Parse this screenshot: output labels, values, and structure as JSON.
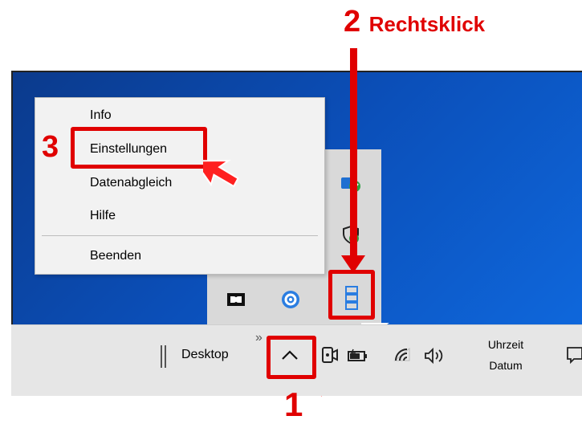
{
  "annotations": {
    "step1": "1",
    "step2_number": "2",
    "step2_text": "Rechtsklick",
    "step3": "3",
    "accent_color": "#e00000"
  },
  "context_menu": {
    "items": [
      {
        "label": "Info"
      },
      {
        "label": "Einstellungen"
      },
      {
        "label": "Datenabgleich"
      },
      {
        "label": "Hilfe"
      },
      {
        "label": "Beenden"
      }
    ]
  },
  "taskbar": {
    "desktop_label": "Desktop",
    "overflow_hint": "»",
    "time_label": "Uhrzeit",
    "date_label": "Datum"
  },
  "icons": {
    "overflow_panel": [
      "bluetooth-like-icon",
      "shield-check-icon",
      "dolby-icon",
      "cloud-swirl-icon",
      "sync-app-icon"
    ],
    "tray": [
      "chevron-up-icon",
      "meet-camera-icon",
      "battery-icon",
      "wifi-icon",
      "volume-icon",
      "notification-icon"
    ]
  }
}
